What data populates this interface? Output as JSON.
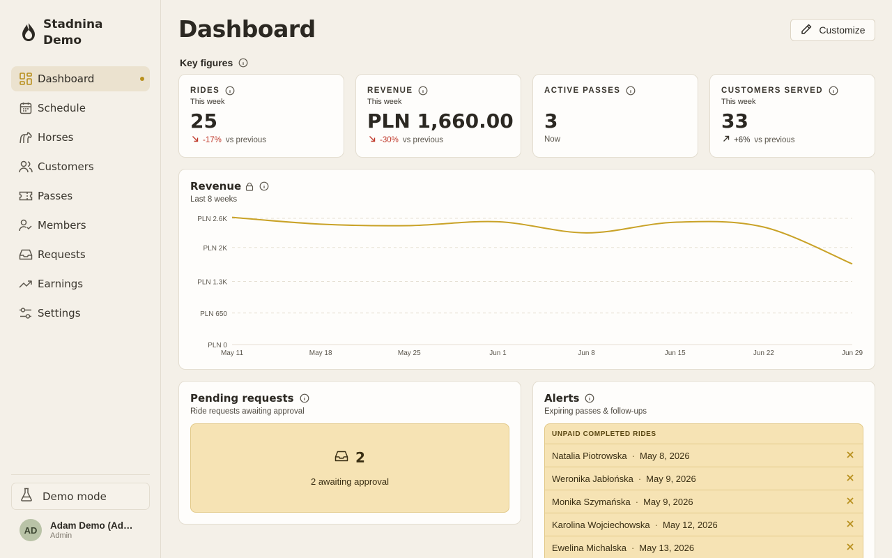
{
  "app": {
    "name": "Stadnina Demo"
  },
  "sidebar": {
    "items": [
      {
        "label": "Dashboard",
        "icon": "dashboard-icon",
        "active": true
      },
      {
        "label": "Schedule",
        "icon": "calendar-icon"
      },
      {
        "label": "Horses",
        "icon": "horse-icon"
      },
      {
        "label": "Customers",
        "icon": "users-icon"
      },
      {
        "label": "Passes",
        "icon": "ticket-icon"
      },
      {
        "label": "Members",
        "icon": "user-check-icon"
      },
      {
        "label": "Requests",
        "icon": "inbox-icon"
      },
      {
        "label": "Earnings",
        "icon": "trending-up-icon"
      },
      {
        "label": "Settings",
        "icon": "sliders-icon"
      }
    ],
    "demo_mode_label": "Demo mode",
    "user": {
      "initials": "AD",
      "name": "Adam Demo (Admin)",
      "role": "Admin"
    }
  },
  "header": {
    "title": "Dashboard",
    "customize_label": "Customize"
  },
  "key_figures": {
    "label": "Key figures",
    "cards": [
      {
        "title": "RIDES",
        "sub": "This week",
        "value": "25",
        "delta": "-17%",
        "delta_text": "vs previous",
        "trend": "down"
      },
      {
        "title": "REVENUE",
        "sub": "This week",
        "value": "PLN 1,660.00",
        "delta": "-30%",
        "delta_text": "vs previous",
        "trend": "down"
      },
      {
        "title": "ACTIVE PASSES",
        "sub": "",
        "value": "3",
        "delta": "",
        "delta_text": "Now",
        "trend": "none"
      },
      {
        "title": "CUSTOMERS SERVED",
        "sub": "This week",
        "value": "33",
        "delta": "+6%",
        "delta_text": "vs previous",
        "trend": "up"
      }
    ]
  },
  "revenue_chart": {
    "title": "Revenue",
    "subtitle": "Last 8 weeks",
    "line_color": "#c9a227"
  },
  "chart_data": {
    "type": "line",
    "title": "Revenue",
    "subtitle": "Last 8 weeks",
    "x": [
      "May 11",
      "May 18",
      "May 25",
      "Jun 1",
      "Jun 8",
      "Jun 15",
      "Jun 22",
      "Jun 29"
    ],
    "y_ticks": [
      "PLN 0",
      "PLN 650",
      "PLN 1.3K",
      "PLN 2K",
      "PLN 2.6K"
    ],
    "y_tick_values": [
      0,
      650,
      1300,
      2000,
      2600
    ],
    "ylim": [
      0,
      2600
    ],
    "series": [
      {
        "values": [
          2620,
          2480,
          2450,
          2530,
          2300,
          2520,
          2420,
          1660
        ]
      }
    ],
    "grid": true
  },
  "pending": {
    "title": "Pending requests",
    "subtitle": "Ride requests awaiting approval",
    "count": "2",
    "text": "2 awaiting approval"
  },
  "alerts": {
    "title": "Alerts",
    "subtitle": "Expiring passes & follow-ups",
    "group_title": "UNPAID COMPLETED RIDES",
    "rows": [
      {
        "name": "Natalia Piotrowska",
        "date": "May 8, 2026"
      },
      {
        "name": "Weronika Jabłońska",
        "date": "May 9, 2026"
      },
      {
        "name": "Monika Szymańska",
        "date": "May 9, 2026"
      },
      {
        "name": "Karolina Wojciechowska",
        "date": "May 12, 2026"
      },
      {
        "name": "Ewelina Michalska",
        "date": "May 13, 2026"
      }
    ]
  },
  "colors": {
    "accent": "#b8901e",
    "background": "#f4f0e8",
    "negative": "#c0392b",
    "alert_bg": "#f6e3b4"
  }
}
